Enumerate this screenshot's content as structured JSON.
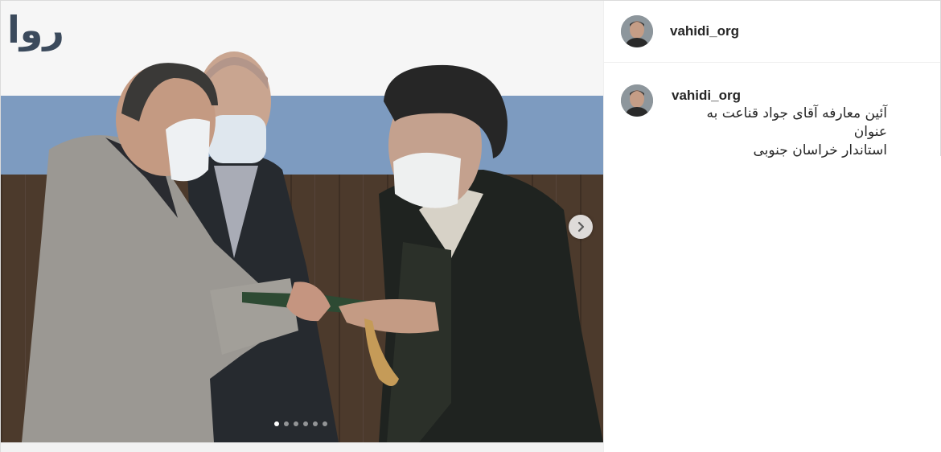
{
  "post": {
    "username": "vahidi_org",
    "caption_lines": [
      "آئین معارفه آقای جواد قناعت به عنوان",
      "استاندار خراسان جنوبی"
    ]
  },
  "media": {
    "banner_text": "روا",
    "carousel": {
      "total_slides": 6,
      "current_slide": 1
    },
    "next_icon": "chevron-right-icon"
  },
  "colors": {
    "text": "#262626",
    "divider": "#efefef",
    "dot_active": "#ffffff"
  }
}
